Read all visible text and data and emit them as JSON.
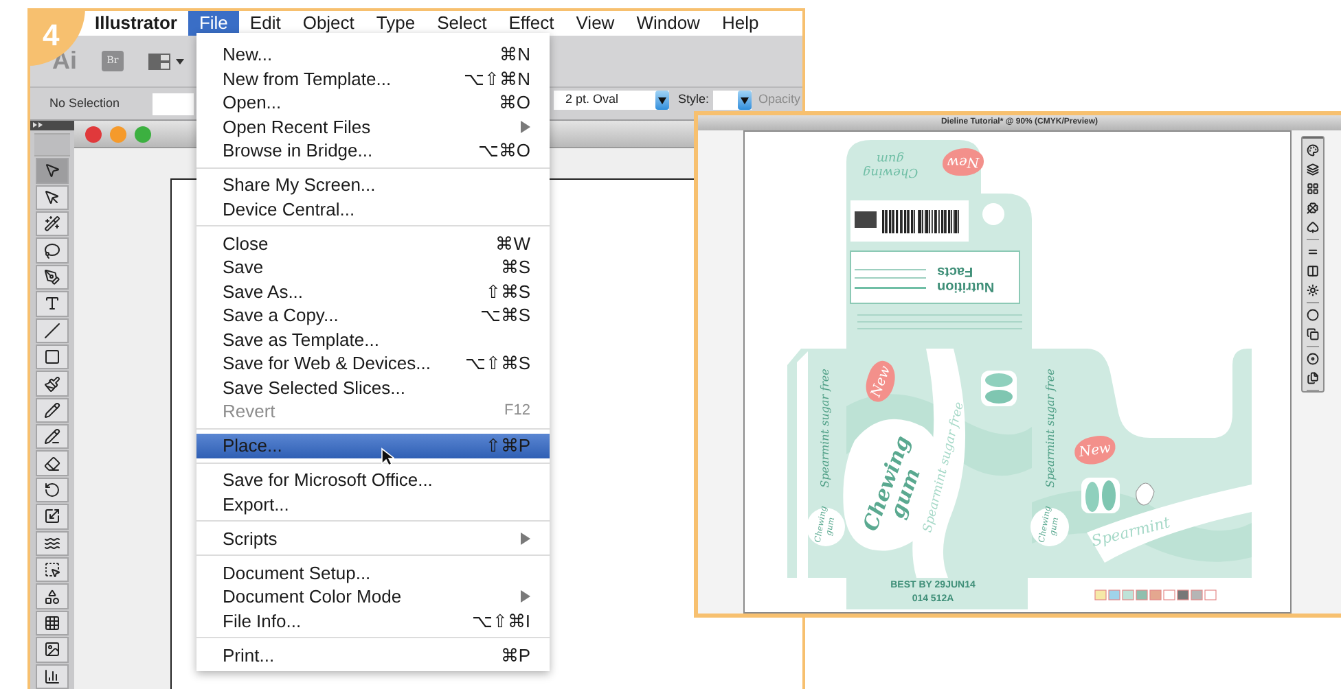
{
  "step_badge": "4",
  "menu_bar": [
    {
      "label": "Illustrator",
      "kind": "app",
      "selected": false
    },
    {
      "label": "File",
      "kind": "menu",
      "selected": true
    },
    {
      "label": "Edit",
      "kind": "menu",
      "selected": false
    },
    {
      "label": "Object",
      "kind": "menu",
      "selected": false
    },
    {
      "label": "Type",
      "kind": "menu",
      "selected": false
    },
    {
      "label": "Select",
      "kind": "menu",
      "selected": false
    },
    {
      "label": "Effect",
      "kind": "menu",
      "selected": false
    },
    {
      "label": "View",
      "kind": "menu",
      "selected": false
    },
    {
      "label": "Window",
      "kind": "menu",
      "selected": false
    },
    {
      "label": "Help",
      "kind": "menu",
      "selected": false
    }
  ],
  "app_toolbar": {
    "logo": "Ai",
    "bridge_button": "Br"
  },
  "control_bar": {
    "selection": "No Selection",
    "brush": "2 pt. Oval",
    "style_label": "Style:",
    "opacity_label": "Opacity"
  },
  "file_menu": [
    [
      {
        "label": "New...",
        "shortcut": "⌘N",
        "submenu": false,
        "disabled": false,
        "selected": false
      },
      {
        "label": "New from Template...",
        "shortcut": "⌥⇧⌘N",
        "submenu": false,
        "disabled": false,
        "selected": false
      },
      {
        "label": "Open...",
        "shortcut": "⌘O",
        "submenu": false,
        "disabled": false,
        "selected": false
      },
      {
        "label": "Open Recent Files",
        "submenu": true,
        "disabled": false,
        "selected": false
      },
      {
        "label": "Browse in Bridge...",
        "shortcut": "⌥⌘O",
        "submenu": false,
        "disabled": false,
        "selected": false
      }
    ],
    [
      {
        "label": "Share My Screen...",
        "submenu": false,
        "disabled": false,
        "selected": false
      },
      {
        "label": "Device Central...",
        "submenu": false,
        "disabled": false,
        "selected": false
      }
    ],
    [
      {
        "label": "Close",
        "shortcut": "⌘W",
        "submenu": false,
        "disabled": false,
        "selected": false
      },
      {
        "label": "Save",
        "shortcut": "⌘S",
        "submenu": false,
        "disabled": false,
        "selected": false
      },
      {
        "label": "Save As...",
        "shortcut": "⇧⌘S",
        "submenu": false,
        "disabled": false,
        "selected": false
      },
      {
        "label": "Save a Copy...",
        "shortcut": "⌥⌘S",
        "submenu": false,
        "disabled": false,
        "selected": false
      },
      {
        "label": "Save as Template...",
        "submenu": false,
        "disabled": false,
        "selected": false
      },
      {
        "label": "Save for Web & Devices...",
        "shortcut": "⌥⇧⌘S",
        "submenu": false,
        "disabled": false,
        "selected": false
      },
      {
        "label": "Save Selected Slices...",
        "submenu": false,
        "disabled": false,
        "selected": false
      },
      {
        "label": "Revert",
        "shortcut": "F12",
        "submenu": false,
        "disabled": true,
        "selected": false
      }
    ],
    [
      {
        "label": "Place...",
        "shortcut": "⇧⌘P",
        "submenu": false,
        "disabled": false,
        "selected": true
      }
    ],
    [
      {
        "label": "Save for Microsoft Office...",
        "submenu": false,
        "disabled": false,
        "selected": false
      },
      {
        "label": "Export...",
        "submenu": false,
        "disabled": false,
        "selected": false
      }
    ],
    [
      {
        "label": "Scripts",
        "submenu": true,
        "disabled": false,
        "selected": false
      }
    ],
    [
      {
        "label": "Document Setup...",
        "submenu": false,
        "disabled": false,
        "selected": false
      },
      {
        "label": "Document Color Mode",
        "submenu": true,
        "disabled": false,
        "selected": false
      },
      {
        "label": "File Info...",
        "shortcut": "⌥⇧⌘I",
        "submenu": false,
        "disabled": false,
        "selected": false
      }
    ],
    [
      {
        "label": "Print...",
        "shortcut": "⌘P",
        "submenu": false,
        "disabled": false,
        "selected": false
      }
    ]
  ],
  "document_window": {
    "title": "Dieline Tutorial* @ 90% (CMYK/Preview)"
  },
  "artwork": {
    "top_flap_label": "Chewing gum",
    "nutrition_title": "Nutrition Facts",
    "badges": [
      "New",
      "New",
      "New"
    ],
    "side_labels": [
      "Spearmint sugar free",
      "Spearmint sugar free"
    ],
    "band_label": "Spearmint sugar free",
    "front_label": "Chewing gum",
    "small_labels": [
      "Chewing gum",
      "Chewing gum"
    ],
    "flavor_label": "Spearmint",
    "best_by": "BEST BY 29JUN14",
    "batch": "014 512A"
  }
}
